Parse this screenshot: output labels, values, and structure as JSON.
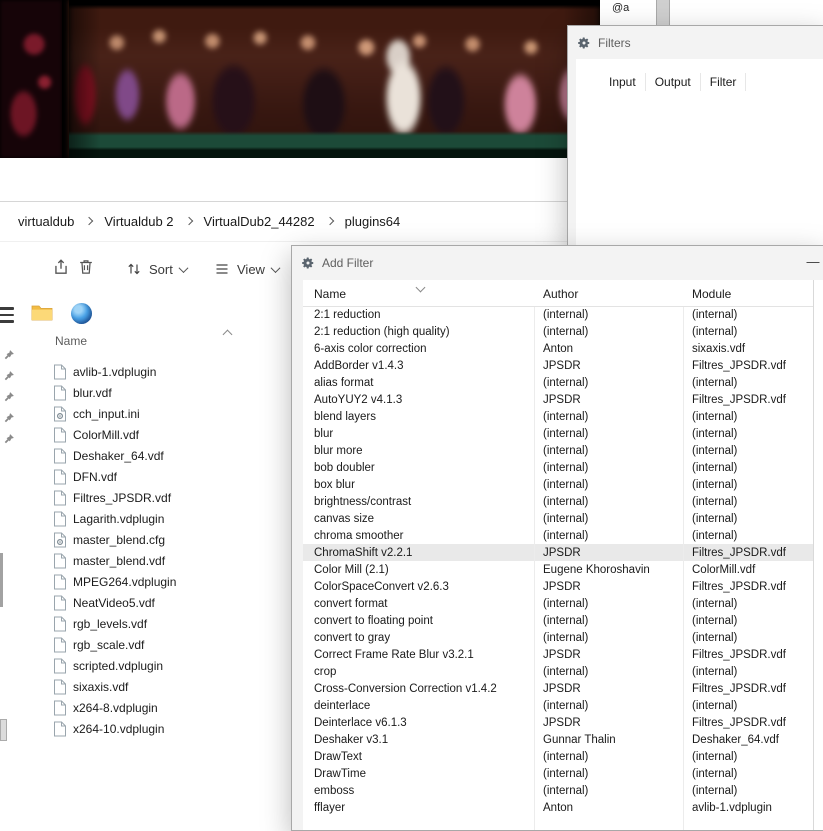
{
  "background_fragment": {
    "text": "@a"
  },
  "filters_dialog": {
    "title": "Filters",
    "tabs": [
      "Input",
      "Output",
      "Filter"
    ]
  },
  "breadcrumb": {
    "items": [
      "virtualdub",
      "Virtualdub 2",
      "VirtualDub2_44282",
      "plugins64"
    ]
  },
  "toolbar": {
    "sort": "Sort",
    "view": "View"
  },
  "file_list": {
    "header": "Name",
    "files": [
      {
        "name": "avlib-1.vdplugin",
        "kind": "doc"
      },
      {
        "name": "blur.vdf",
        "kind": "doc"
      },
      {
        "name": "cch_input.ini",
        "kind": "config"
      },
      {
        "name": "ColorMill.vdf",
        "kind": "doc"
      },
      {
        "name": "Deshaker_64.vdf",
        "kind": "doc"
      },
      {
        "name": "DFN.vdf",
        "kind": "doc"
      },
      {
        "name": "Filtres_JPSDR.vdf",
        "kind": "doc"
      },
      {
        "name": "Lagarith.vdplugin",
        "kind": "doc"
      },
      {
        "name": "master_blend.cfg",
        "kind": "config"
      },
      {
        "name": "master_blend.vdf",
        "kind": "doc"
      },
      {
        "name": "MPEG264.vdplugin",
        "kind": "doc"
      },
      {
        "name": "NeatVideo5.vdf",
        "kind": "doc"
      },
      {
        "name": "rgb_levels.vdf",
        "kind": "doc"
      },
      {
        "name": "rgb_scale.vdf",
        "kind": "doc"
      },
      {
        "name": "scripted.vdplugin",
        "kind": "doc"
      },
      {
        "name": "sixaxis.vdf",
        "kind": "doc"
      },
      {
        "name": "x264-8.vdplugin",
        "kind": "doc"
      },
      {
        "name": "x264-10.vdplugin",
        "kind": "doc"
      }
    ]
  },
  "add_filter_dialog": {
    "title": "Add Filter",
    "columns": [
      "Name",
      "Author",
      "Module"
    ],
    "rows": [
      {
        "name": "2:1 reduction",
        "author": "(internal)",
        "module": "(internal)"
      },
      {
        "name": "2:1 reduction (high quality)",
        "author": "(internal)",
        "module": "(internal)"
      },
      {
        "name": "6-axis color correction",
        "author": "Anton",
        "module": "sixaxis.vdf"
      },
      {
        "name": "AddBorder v1.4.3",
        "author": "JPSDR",
        "module": "Filtres_JPSDR.vdf"
      },
      {
        "name": "alias format",
        "author": "(internal)",
        "module": "(internal)"
      },
      {
        "name": "AutoYUY2 v4.1.3",
        "author": "JPSDR",
        "module": "Filtres_JPSDR.vdf"
      },
      {
        "name": "blend layers",
        "author": "(internal)",
        "module": "(internal)"
      },
      {
        "name": "blur",
        "author": "(internal)",
        "module": "(internal)"
      },
      {
        "name": "blur more",
        "author": "(internal)",
        "module": "(internal)"
      },
      {
        "name": "bob doubler",
        "author": "(internal)",
        "module": "(internal)"
      },
      {
        "name": "box blur",
        "author": "(internal)",
        "module": "(internal)"
      },
      {
        "name": "brightness/contrast",
        "author": "(internal)",
        "module": "(internal)"
      },
      {
        "name": "canvas size",
        "author": "(internal)",
        "module": "(internal)"
      },
      {
        "name": "chroma smoother",
        "author": "(internal)",
        "module": "(internal)"
      },
      {
        "name": "ChromaShift v2.2.1",
        "author": "JPSDR",
        "module": "Filtres_JPSDR.vdf",
        "selected": true
      },
      {
        "name": "Color Mill (2.1)",
        "author": "Eugene Khoroshavin",
        "module": "ColorMill.vdf"
      },
      {
        "name": "ColorSpaceConvert v2.6.3",
        "author": "JPSDR",
        "module": "Filtres_JPSDR.vdf"
      },
      {
        "name": "convert format",
        "author": "(internal)",
        "module": "(internal)"
      },
      {
        "name": "convert to floating point",
        "author": "(internal)",
        "module": "(internal)"
      },
      {
        "name": "convert to gray",
        "author": "(internal)",
        "module": "(internal)"
      },
      {
        "name": "Correct Frame Rate Blur v3.2.1",
        "author": "JPSDR",
        "module": "Filtres_JPSDR.vdf"
      },
      {
        "name": "crop",
        "author": "(internal)",
        "module": "(internal)"
      },
      {
        "name": "Cross-Conversion Correction v1.4.2",
        "author": "JPSDR",
        "module": "Filtres_JPSDR.vdf"
      },
      {
        "name": "deinterlace",
        "author": "(internal)",
        "module": "(internal)"
      },
      {
        "name": "Deinterlace v6.1.3",
        "author": "JPSDR",
        "module": "Filtres_JPSDR.vdf"
      },
      {
        "name": "Deshaker v3.1",
        "author": "Gunnar Thalin",
        "module": "Deshaker_64.vdf"
      },
      {
        "name": "DrawText",
        "author": "(internal)",
        "module": "(internal)"
      },
      {
        "name": "DrawTime",
        "author": "(internal)",
        "module": "(internal)"
      },
      {
        "name": "emboss",
        "author": "(internal)",
        "module": "(internal)"
      },
      {
        "name": "fflayer",
        "author": "Anton",
        "module": "avlib-1.vdplugin"
      }
    ]
  }
}
